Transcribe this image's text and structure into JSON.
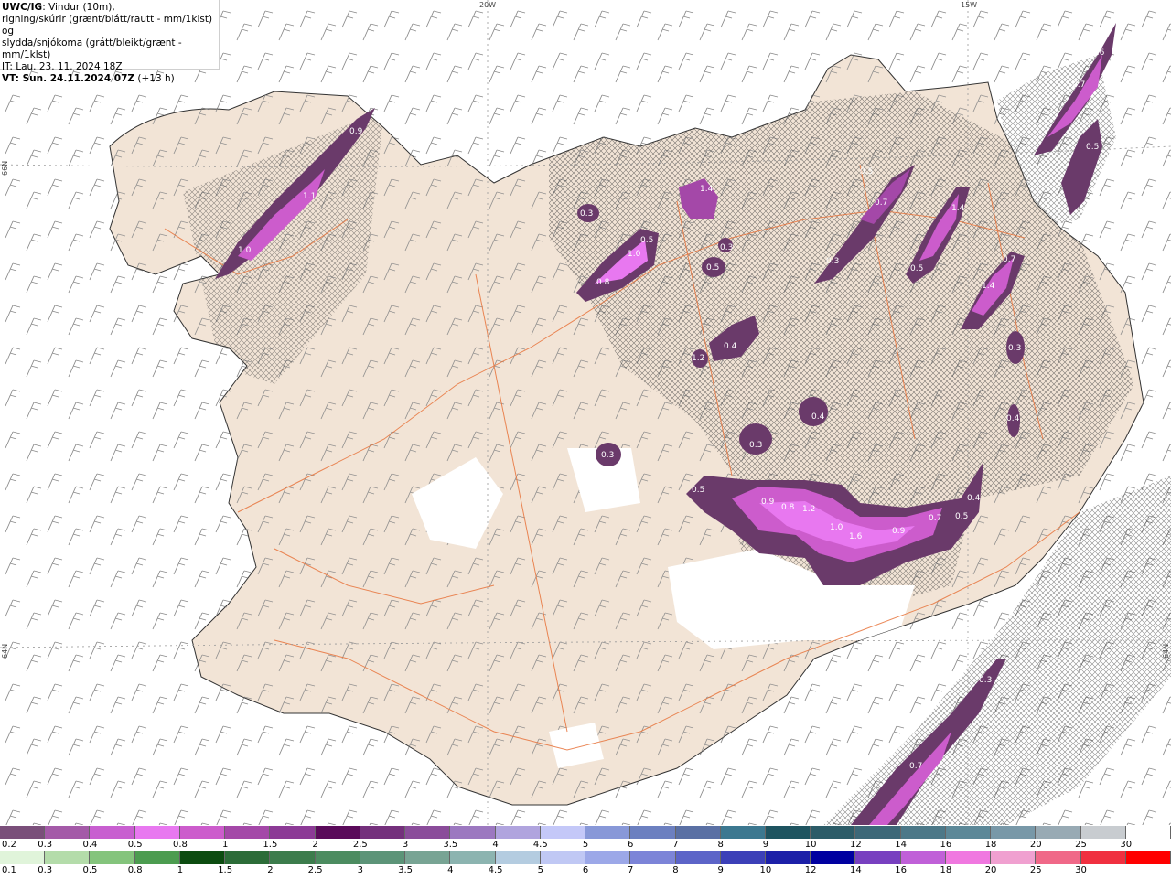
{
  "header": {
    "product": "UWC/IG",
    "line1_rest": ": Vindur (10m),",
    "line2": "rigning/skúrir (grænt/blátt/rautt - mm/1klst) og",
    "line3": "slydda/snjókoma (grátt/bleikt/grænt - mm/1klst)",
    "it_line": "IT: Lau. 23. 11. 2024 18Z",
    "vt_label": "VT: Sun. 24.11.2024 07Z",
    "vt_offset": " (+13 h)"
  },
  "grid_labels": {
    "lon_20w": "20W",
    "lon_15w": "15W",
    "lat_66n": "66N",
    "lat_64n_left": "64N",
    "lat_64n_right": "64N"
  },
  "precip_values": {
    "v_westfjords_top": "0.9",
    "v_westfjords_mid": "1.1",
    "v_westfjords_low": "1.0",
    "v_skagi": "0.3",
    "v_trollaskagi_a": "0.5",
    "v_trollaskagi_b": "1.0",
    "v_trollaskagi_c": "0.8",
    "v_eyja": "1.4",
    "v_north_a": "0.5",
    "v_north_b": "0.3",
    "v_north_c": "0.4",
    "v_north_d": "1.2",
    "v_ne_a": "0.5",
    "v_ne_b": "0.7",
    "v_ne_c": "0.3",
    "v_ne_d": "1.4",
    "v_ne_e": "0.5",
    "v_ne_f": "0.7",
    "v_ne_g": "1.4",
    "v_east_a": "0.3",
    "v_east_b": "0.4",
    "v_center_a": "0.4",
    "v_center_b": "0.3",
    "v_langjokull": "0.3",
    "v_south_a": "0.5",
    "v_south_b": "0.9",
    "v_south_c": "0.8",
    "v_south_d": "1.2",
    "v_south_e": "1.0",
    "v_south_f": "1.6",
    "v_south_g": "0.9",
    "v_south_h": "0.7",
    "v_south_i": "0.5",
    "v_south_j": "0.4",
    "v_far_ne_a": "0.6",
    "v_far_ne_b": "0.7",
    "v_far_ne_c": "0.5",
    "v_se_sea_a": "0.3",
    "v_se_sea_b": "0.7"
  },
  "legend_snow": {
    "labels": [
      "0.2",
      "0.3",
      "0.4",
      "0.5",
      "0.8",
      "1",
      "1.5",
      "2",
      "2.5",
      "3",
      "3.5",
      "4",
      "4.5",
      "5",
      "6",
      "7",
      "8",
      "9",
      "10",
      "12",
      "14",
      "16",
      "18",
      "20",
      "25",
      "30"
    ],
    "colors": [
      "#7a4f7a",
      "#a45aa8",
      "#c85fd0",
      "#e878f0",
      "#cc5ccc",
      "#a448a8",
      "#8c3a96",
      "#5a0a5a",
      "#74307c",
      "#8a4c9a",
      "#9c78c0",
      "#b0a4de",
      "#c4c8f8",
      "#8898d8",
      "#6c80c0",
      "#5a70a4",
      "#3c7890",
      "#1e5460",
      "#2c5c68",
      "#3c6878",
      "#4c7888",
      "#5c8898",
      "#7898a8",
      "#98aab4",
      "#c8ccd0",
      "#ffffff"
    ]
  },
  "legend_rain": {
    "labels": [
      "0.1",
      "0.3",
      "0.5",
      "0.8",
      "1",
      "1.5",
      "2",
      "2.5",
      "3",
      "3.5",
      "4",
      "4.5",
      "5",
      "6",
      "7",
      "8",
      "9",
      "10",
      "12",
      "14",
      "16",
      "18",
      "20",
      "25",
      "30"
    ],
    "colors": [
      "#e0f4da",
      "#b4dcaa",
      "#84c47c",
      "#4c9c50",
      "#0c4c10",
      "#2c6c38",
      "#3c7c4c",
      "#4c8c60",
      "#5c9478",
      "#78a494",
      "#8cb4b0",
      "#b4cce0",
      "#c0c8f4",
      "#9ca8e8",
      "#7c84d8",
      "#5c64c8",
      "#3c40b8",
      "#1c20a8",
      "#0000a0",
      "#7840c0",
      "#c060d8",
      "#f078e0",
      "#f0a0d0",
      "#f06888",
      "#f03040",
      "#ff0000"
    ]
  }
}
